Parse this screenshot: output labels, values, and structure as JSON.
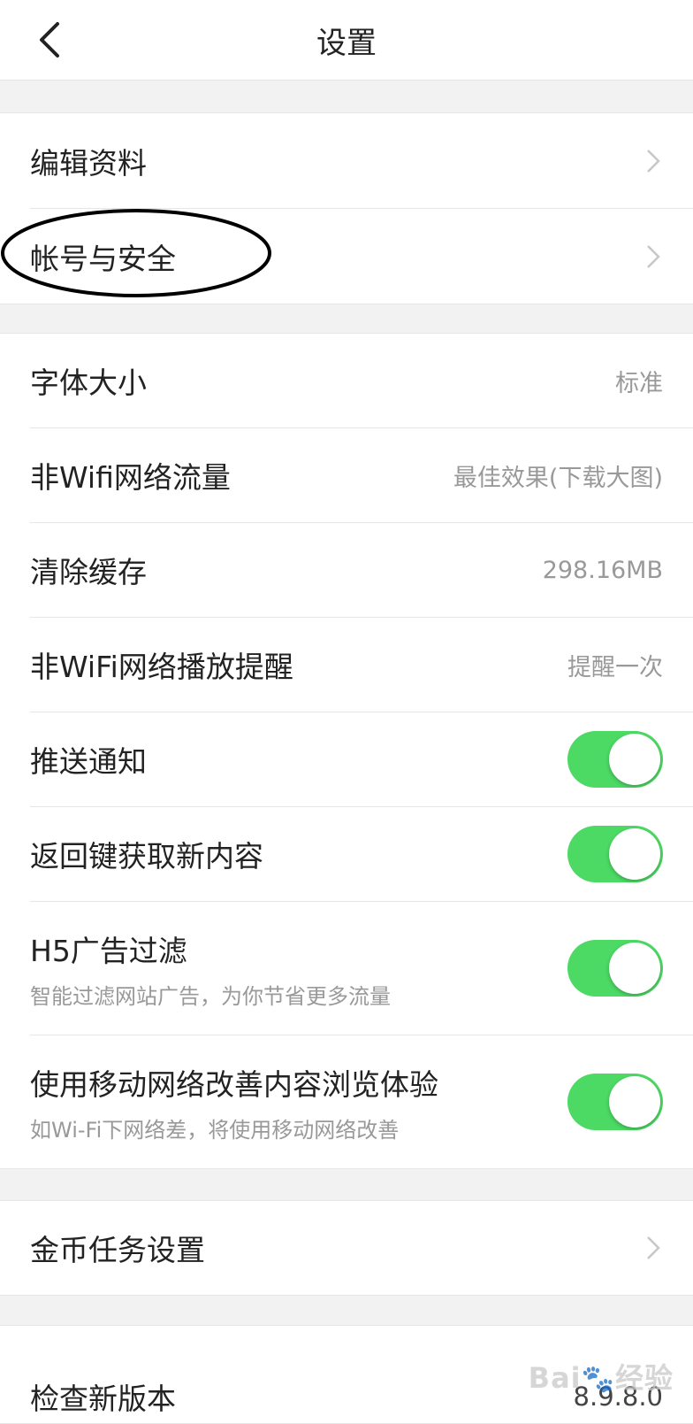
{
  "header": {
    "title": "设置",
    "back_icon": "chevron-left-icon"
  },
  "group1": {
    "items": [
      {
        "label": "编辑资料"
      },
      {
        "label": "帐号与安全"
      }
    ]
  },
  "group2": {
    "items": [
      {
        "label": "字体大小",
        "value": "标准"
      },
      {
        "label": "非Wifi网络流量",
        "value": "最佳效果(下载大图)"
      },
      {
        "label": "清除缓存",
        "value": "298.16MB"
      },
      {
        "label": "非WiFi网络播放提醒",
        "value": "提醒一次"
      },
      {
        "label": "推送通知",
        "toggle": true
      },
      {
        "label": "返回键获取新内容",
        "toggle": true
      },
      {
        "label": "H5广告过滤",
        "sub": "智能过滤网站广告，为你节省更多流量",
        "toggle": true
      },
      {
        "label": "使用移动网络改善内容浏览体验",
        "sub": "如Wi-Fi下网络差，将使用移动网络改善",
        "toggle": true
      }
    ]
  },
  "group3": {
    "items": [
      {
        "label": "金币任务设置"
      }
    ]
  },
  "group4": {
    "items": [
      {
        "label": "检查新版本",
        "value": "8.9.8.0"
      }
    ]
  },
  "colors": {
    "toggle_on": "#4cd964",
    "background": "#f2f2f2",
    "annotation": "#000000"
  },
  "watermark": {
    "brand": "Bai",
    "paw": "🐾",
    "suffix": "经验"
  }
}
